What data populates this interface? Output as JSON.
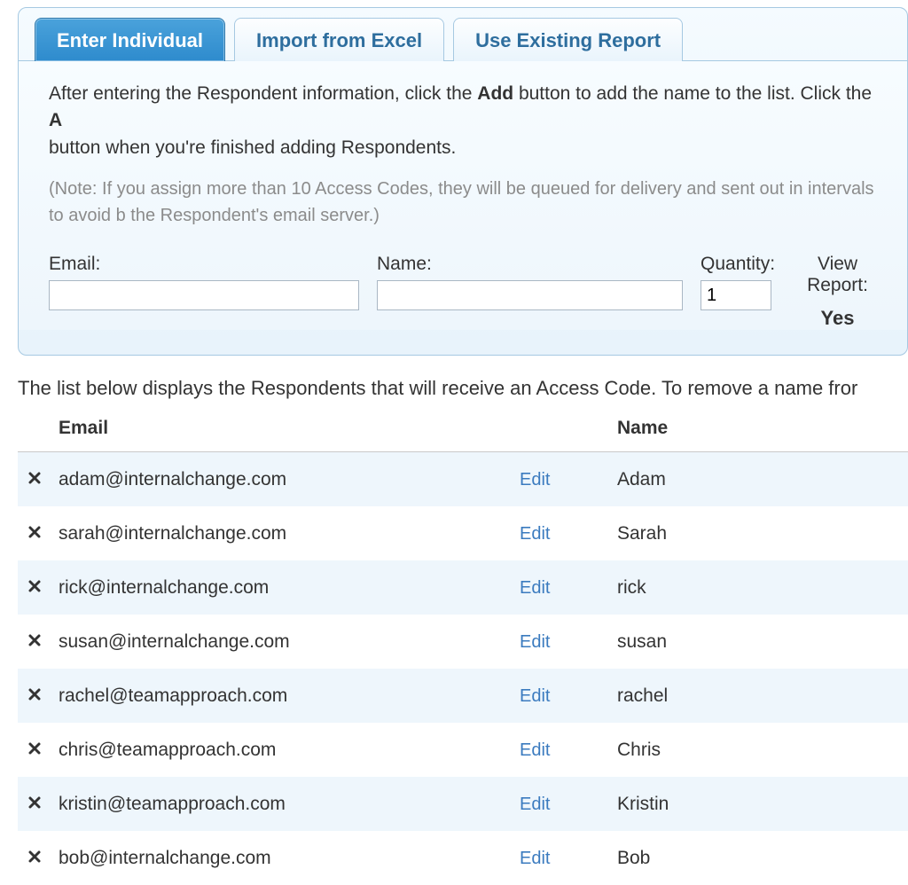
{
  "tabs": {
    "enter_individual": "Enter Individual",
    "import_excel": "Import from Excel",
    "use_existing": "Use Existing Report"
  },
  "intro": {
    "part1": "After entering the Respondent information, click the ",
    "bold1": "Add",
    "part2": " button to add the name to the list. Click the ",
    "bold2": "A",
    "part3": " button when you're finished adding Respondents."
  },
  "note": "(Note: If you assign more than 10 Access Codes, they will be queued for delivery and sent out in intervals to avoid b the Respondent's email server.)",
  "form": {
    "email_label": "Email:",
    "name_label": "Name:",
    "quantity_label": "Quantity:",
    "quantity_value": "1",
    "view_report_label": "View Report:",
    "view_report_value": "Yes"
  },
  "list_intro": "The list below displays the Respondents that will receive an Access Code. To remove a name fror",
  "table": {
    "header_email": "Email",
    "header_name": "Name",
    "edit_label": "Edit",
    "rows": [
      {
        "email": "adam@internalchange.com",
        "name": "Adam"
      },
      {
        "email": "sarah@internalchange.com",
        "name": "Sarah"
      },
      {
        "email": "rick@internalchange.com",
        "name": "rick"
      },
      {
        "email": "susan@internalchange.com",
        "name": "susan"
      },
      {
        "email": "rachel@teamapproach.com",
        "name": "rachel"
      },
      {
        "email": "chris@teamapproach.com",
        "name": "Chris"
      },
      {
        "email": "kristin@teamapproach.com",
        "name": "Kristin"
      },
      {
        "email": "bob@internalchange.com",
        "name": "Bob"
      }
    ]
  }
}
